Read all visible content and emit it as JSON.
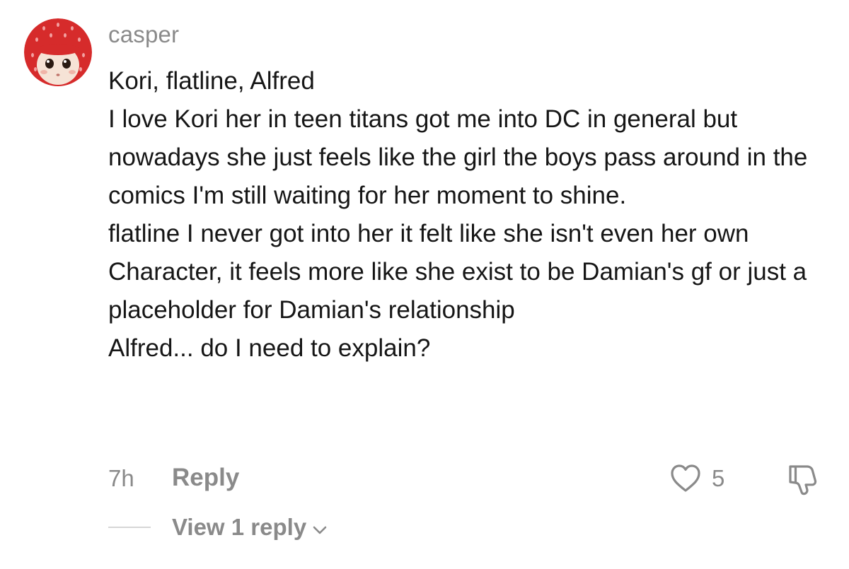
{
  "comment": {
    "username": "casper",
    "body": "Kori, flatline, Alfred\nI love Kori her in teen titans got me into DC in general but nowadays she just feels like the girl the boys pass around in the comics I'm still waiting for her moment to shine.\nflatline I never got into her it felt like she isn't even her own Character, it feels more like she exist to be Damian's gf or just a placeholder for Damian's relationship\nAlfred... do I need to explain?",
    "timestamp": "7h",
    "reply_label": "Reply",
    "like_count": "5",
    "view_replies_label": "View 1 reply",
    "icons": {
      "avatar": "strawberry-doll-avatar",
      "like": "heart-outline-icon",
      "dislike": "thumbs-down-outline-icon",
      "expand": "chevron-down-icon"
    },
    "colors": {
      "text": "#161616",
      "muted": "#8a8a8a",
      "avatar_red": "#d62b2b"
    }
  }
}
